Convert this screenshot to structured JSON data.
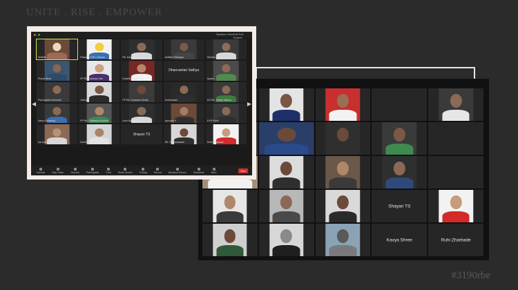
{
  "slogan": "UNITE . RISE . EMPOWER",
  "hashtag": "#3190rbe",
  "gallery_small": {
    "top_bar": {
      "speaker_view": "Speaker View",
      "exit_full_screen": "Exit Full Screen"
    },
    "end_label": "End",
    "toolbar": [
      "Unmute",
      "Stop Video",
      "Security",
      "Participants",
      "Chat",
      "Share Screen",
      "Polling",
      "Record",
      "Breakout Rooms",
      "Reactions",
      "More"
    ],
    "tiles": [
      {
        "name": "Hrishita",
        "photo": true,
        "c": [
          "#6b4a3a",
          "#f1d7c0",
          "#9b6b55"
        ],
        "active": true
      },
      {
        "name": "Rotaract 3190 | Sharan",
        "photo": true,
        "c": [
          "#f3f3f3",
          "#f2cf3a",
          "#3a6fb0"
        ]
      },
      {
        "name": "Rtr. Kaushik",
        "photo": true,
        "c": [
          "#2f2f2f",
          "#8a6a55",
          "#d9d9d9"
        ]
      },
      {
        "name": "Ankitha Shivappa",
        "photo": true,
        "c": [
          "#3a3a3a",
          "#7a5a48",
          "#444"
        ]
      },
      {
        "name": "Shivam Ladhe",
        "photo": true,
        "c": [
          "#3b3b3b",
          "#8e6b56",
          "#d7d7d7"
        ]
      },
      {
        "name": "Pranav Bhat",
        "photo": true,
        "c": [
          "#3b5670",
          "#8a6550",
          "#2e4a6a"
        ]
      },
      {
        "name": "PP Rtr. Sukanya Jain",
        "photo": true,
        "c": [
          "#e8e8e8",
          "#caa287",
          "#4a2f6a"
        ]
      },
      {
        "name": "Kaushik Raghuveer",
        "photo": true,
        "c": [
          "#7a2626",
          "#b78668",
          "#f2f2f2"
        ]
      },
      {
        "name": "Dhanvantari Sathya",
        "photo": false,
        "c": [
          "#1a1a1a",
          "#1a1a1a",
          "#1a1a1a"
        ]
      },
      {
        "name": "Ayaan",
        "photo": true,
        "c": [
          "#4b4b4b",
          "#8d6a55",
          "#4f8a4f"
        ]
      },
      {
        "name": "Poorvajatha Hemanth",
        "photo": true,
        "c": [
          "#3a3a3a",
          "#8d6a55",
          "#3a3a3a"
        ]
      },
      {
        "name": "Joshua",
        "photo": true,
        "c": [
          "#d9d9d9",
          "#7a5a46",
          "#2b2b2b"
        ]
      },
      {
        "name": "PP Rtr. Goutham Shetty",
        "photo": true,
        "c": [
          "#3c3c3c",
          "#6b4a3a",
          "#3a3a3a"
        ]
      },
      {
        "name": "Kruthivasan",
        "photo": true,
        "c": [
          "#2a2a2a",
          "#8d6a55",
          "#2f2f2f"
        ]
      },
      {
        "name": "DZ Rtr. Joseph Wilson",
        "photo": true,
        "c": [
          "#3a3a3a",
          "#8a6a55",
          "#3f7a3f"
        ]
      },
      {
        "name": "Varun Vishwaraj",
        "photo": true,
        "c": [
          "#3a3a3a",
          "#8a6a55",
          "#3a6fb0"
        ]
      },
      {
        "name": "PP Rtr. Chaitanya Krishna",
        "photo": true,
        "c": [
          "#555",
          "#b0876a",
          "#3a8a5a"
        ]
      },
      {
        "name": "Arun Kashyap",
        "photo": true,
        "c": [
          "#2f2f2f",
          "#8a6a55",
          "#d8d8d8"
        ]
      },
      {
        "name": "Apoorva S",
        "photo": true,
        "c": [
          "#6a4a3a",
          "#a57c62",
          "#2f2f2f"
        ]
      },
      {
        "name": "DYR Rohit",
        "photo": true,
        "c": [
          "#3a3a3a",
          "#8a6a55",
          "#2f2f2f"
        ]
      },
      {
        "name": "Isa Kadhanya",
        "photo": true,
        "c": [
          "#8a6a55",
          "#b99074",
          "#d7d7d7"
        ]
      },
      {
        "name": "Keerthy Reddy",
        "photo": true,
        "c": [
          "#d5d5d5",
          "#a88468",
          "#e3e3e3"
        ]
      },
      {
        "name": "Shayan TS",
        "photo": false,
        "c": [
          "#262626",
          "#262626",
          "#262626"
        ]
      },
      {
        "name": "Rtr. Vigneshwaran",
        "photo": true,
        "c": [
          "#d7d7d7",
          "#6b4a3a",
          "#2f2f2f"
        ]
      },
      {
        "name": "Ruthi Zharbade",
        "photo": true,
        "c": [
          "#f2f2f2",
          "#c99b7d",
          "#d32a2a"
        ]
      }
    ],
    "center_name": "Shayan TS"
  },
  "gallery_big": {
    "tiles": [
      {
        "name": "",
        "photo": false
      },
      {
        "name": "",
        "photo": true,
        "c": [
          "#e4e4e4",
          "#7a5646",
          "#1f2f6a"
        ]
      },
      {
        "name": "",
        "photo": true,
        "c": [
          "#c83030",
          "#9a6e55",
          "#f2f2f2"
        ]
      },
      {
        "name": "",
        "photo": false
      },
      {
        "name": "",
        "photo": true,
        "c": [
          "#3a3a3a",
          "#8a6a55",
          "#e6e6e6"
        ]
      },
      {
        "name": "",
        "photo": true,
        "wide": true,
        "c": [
          "#3b3b3b",
          "#8a6a55",
          "#2a2a2a"
        ]
      },
      {
        "name": "",
        "photo": true,
        "wide": true,
        "c": [
          "#2a3e6a",
          "#6b4a3a",
          "#2a4a8a"
        ]
      },
      {
        "name": "",
        "photo": true,
        "c": [
          "#2f2f2f",
          "#6b4a3a",
          "#2f2f2f"
        ]
      },
      {
        "name": "",
        "photo": true,
        "c": [
          "#3a3a3a",
          "#7a5a46",
          "#3f8a4f"
        ]
      },
      {
        "name": "",
        "photo": false
      },
      {
        "name": "",
        "photo": true,
        "wide": true,
        "c": [
          "#a48e78",
          "#c7a083",
          "#f2f2f2"
        ]
      },
      {
        "name": "",
        "photo": true,
        "c": [
          "#dcdcdc",
          "#6b4a3a",
          "#2f2f2f"
        ]
      },
      {
        "name": "",
        "photo": true,
        "c": [
          "#6a5848",
          "#b0876a",
          "#3a3a3a"
        ]
      },
      {
        "name": "",
        "photo": true,
        "c": [
          "#2f2f2f",
          "#8a6a55",
          "#2f4a7a"
        ]
      },
      {
        "name": "",
        "photo": false
      },
      {
        "name": "",
        "photo": true,
        "c": [
          "#e6e6e6",
          "#b0876a",
          "#3a3a3a"
        ]
      },
      {
        "name": "",
        "photo": true,
        "c": [
          "#b8b8b8",
          "#8a6a55",
          "#4a4a4a"
        ]
      },
      {
        "name": "",
        "photo": true,
        "c": [
          "#d9d9d9",
          "#6b4a3a",
          "#2a2a2a"
        ]
      },
      {
        "name": "Shayan TS",
        "photo": false,
        "center": true
      },
      {
        "name": "",
        "photo": true,
        "c": [
          "#f2f2f2",
          "#c99b7d",
          "#d32a2a"
        ]
      },
      {
        "name": "",
        "photo": true,
        "c": [
          "#cfcfcf",
          "#6b4a3a",
          "#2f5a3a"
        ]
      },
      {
        "name": "",
        "photo": true,
        "c": [
          "#d7d7d7",
          "#8a8a8a",
          "#1f1f1f"
        ]
      },
      {
        "name": "",
        "photo": true,
        "c": [
          "#8aa3b5",
          "#5a5a5a",
          "#7a7a7a"
        ]
      },
      {
        "name": "Kavya Shree",
        "photo": false,
        "center": true
      },
      {
        "name": "Ruhi Zharbade",
        "photo": false,
        "center": true
      }
    ]
  }
}
